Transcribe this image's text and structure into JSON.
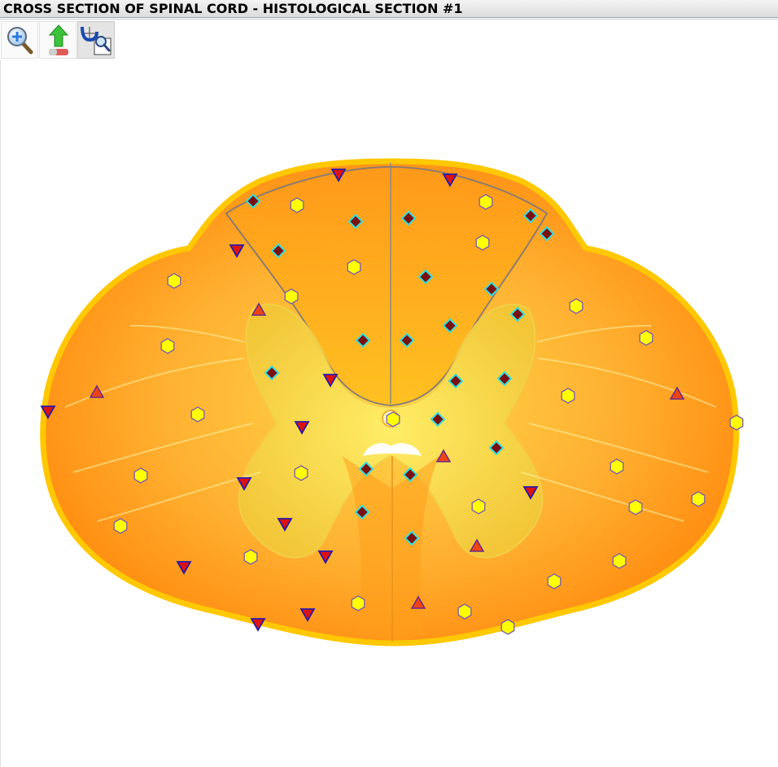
{
  "window": {
    "title": "CROSS SECTION OF SPINAL CORD - HISTOLOGICAL SECTION #1"
  },
  "toolbar": {
    "buttons": [
      {
        "name": "zoom-in-button",
        "icon": "magnifier-plus-icon"
      },
      {
        "name": "clear-markers-button",
        "icon": "green-arrow-eraser-icon"
      },
      {
        "name": "select-zoom-button",
        "icon": "selection-magnifier-icon",
        "active": true
      }
    ]
  },
  "image": {
    "subject": "spinal-cord-cross-section",
    "marker_colors": {
      "hexagon": "#ffff00",
      "diamond": "#7a1010",
      "diamond_outline": "#33dddd",
      "tri_down": "#dd1111",
      "tri_down_outline": "#2a1aa8",
      "tri_up": "#ee4411",
      "tri_up_outline": "#6a2a8a"
    }
  }
}
